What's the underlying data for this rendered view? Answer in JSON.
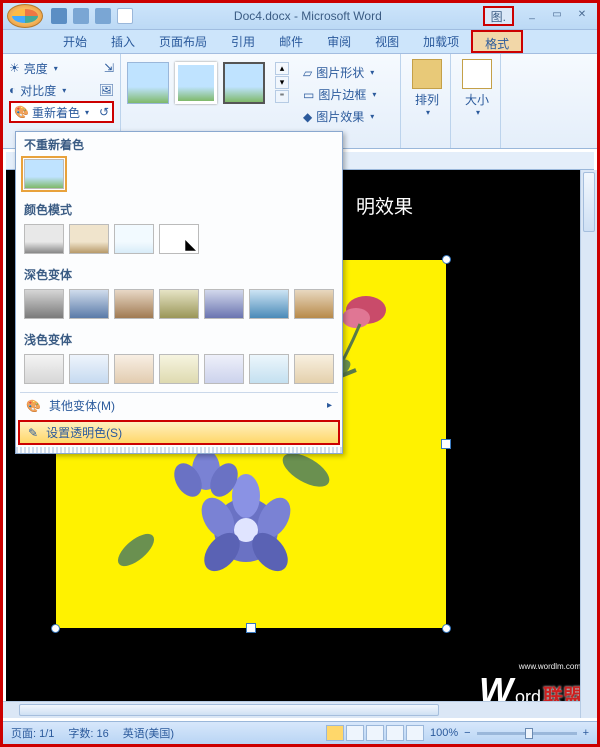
{
  "title": {
    "doc": "Doc4.docx",
    "app": "Microsoft Word",
    "tools_tab": "图."
  },
  "tabs": [
    "开始",
    "插入",
    "页面布局",
    "引用",
    "邮件",
    "审阅",
    "视图",
    "加载项",
    "格式"
  ],
  "ribbon": {
    "adjust": {
      "brightness": "亮度",
      "contrast": "对比度",
      "recolor": "重新着色"
    },
    "picture_border_group": {
      "shape": "图片形状",
      "border": "图片边框",
      "effects": "图片效果"
    },
    "arrange": "排列",
    "size": "大小"
  },
  "recolor_dropdown": {
    "section_no_recolor": "不重新着色",
    "section_color_modes": "颜色模式",
    "section_dark_variants": "深色变体",
    "section_light_variants": "浅色变体",
    "more_variants": "其他变体(M)",
    "set_transparent": "设置透明色(S)"
  },
  "document": {
    "visible_text": "明效果"
  },
  "status": {
    "page": "页面: 1/1",
    "words": "字数: 16",
    "lang": "英语(美国)",
    "zoom": "100%"
  },
  "watermark": {
    "brand": "Word",
    "suffix": "联盟",
    "url": "www.wordlm.com"
  }
}
